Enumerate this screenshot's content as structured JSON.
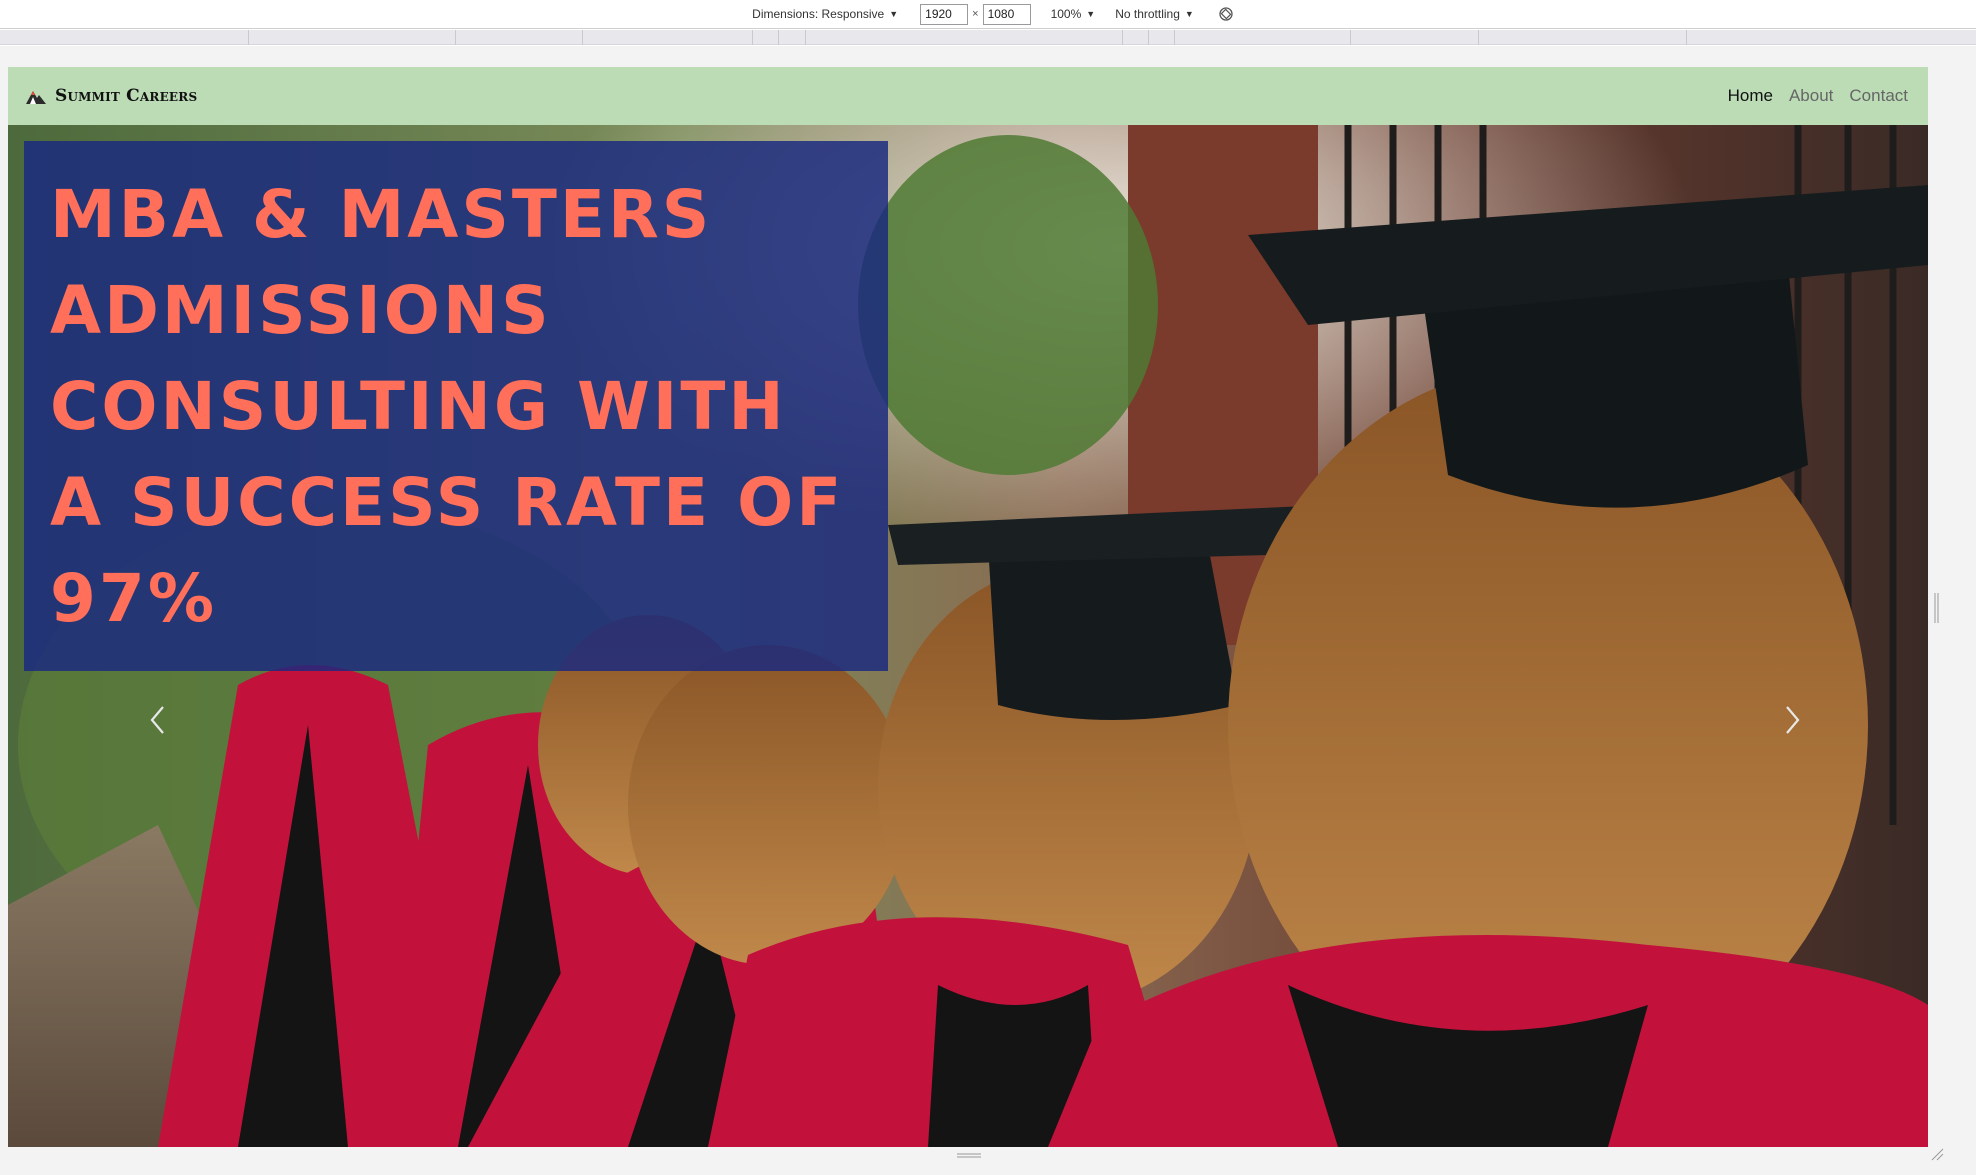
{
  "devtools": {
    "dimensions_label": "Dimensions: Responsive",
    "width_value": "1920",
    "height_value": "1080",
    "times": "×",
    "zoom": "100%",
    "throttling": "No throttling",
    "rotate_icon": "rotate-icon"
  },
  "navbar": {
    "brand": "Summit Careers",
    "logo_icon": "mountain-logo-icon",
    "links": [
      {
        "label": "Home",
        "active": true
      },
      {
        "label": "About",
        "active": false
      },
      {
        "label": "Contact",
        "active": false
      }
    ]
  },
  "hero": {
    "headline": "MBA & Masters Admissions Consulting with a Success Rate of 97%",
    "image_subject": "graduates in caps and gowns walking away",
    "prev_icon": "chevron-left-icon",
    "next_icon": "chevron-right-icon"
  },
  "colors": {
    "navbar_bg": "#bcdcb6",
    "headline_box_bg": "#1a2a80",
    "headline_text": "#ff6f59",
    "gown_red": "#c2123b"
  }
}
